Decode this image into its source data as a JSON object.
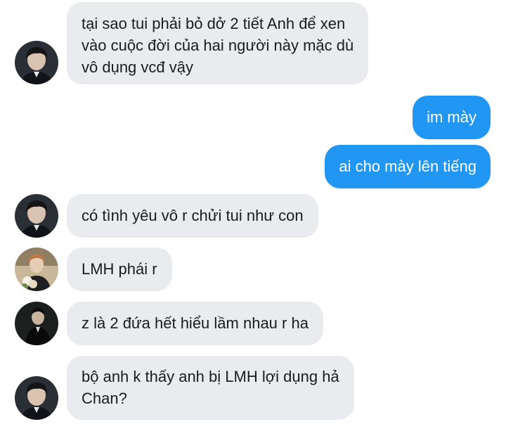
{
  "conversation": {
    "messages": [
      {
        "direction": "incoming",
        "avatar": "avatar-boy-dark-hair",
        "lines": [
          "tại sao tui phải bỏ dở 2 tiết Anh để xen",
          "vào cuộc đời của hai người này mặc dù",
          "vô dụng vcđ vậy"
        ]
      },
      {
        "direction": "outgoing",
        "lines": [
          "im mày"
        ]
      },
      {
        "direction": "outgoing",
        "lines": [
          "ai cho mày lên tiếng"
        ]
      },
      {
        "direction": "incoming",
        "avatar": "avatar-boy-dark-hair",
        "lines": [
          "có tình yêu vô r chửi tui như con"
        ]
      },
      {
        "direction": "incoming",
        "avatar": "avatar-boy-flowers",
        "lines": [
          "LMH phái r"
        ]
      },
      {
        "direction": "incoming",
        "avatar": "avatar-boy-dark-suit",
        "lines": [
          "z là 2 đứa hết hiểu lầm nhau r ha"
        ]
      },
      {
        "direction": "incoming",
        "avatar": "avatar-boy-dark-hair",
        "lines": [
          "bộ anh k thấy anh bị LMH lợi dụng hả",
          "Chan?"
        ]
      }
    ]
  },
  "colors": {
    "incoming_bubble": "#e9ebee",
    "outgoing_bubble": "#2196f3",
    "incoming_text": "#1c1c1c",
    "outgoing_text": "#ffffff"
  }
}
